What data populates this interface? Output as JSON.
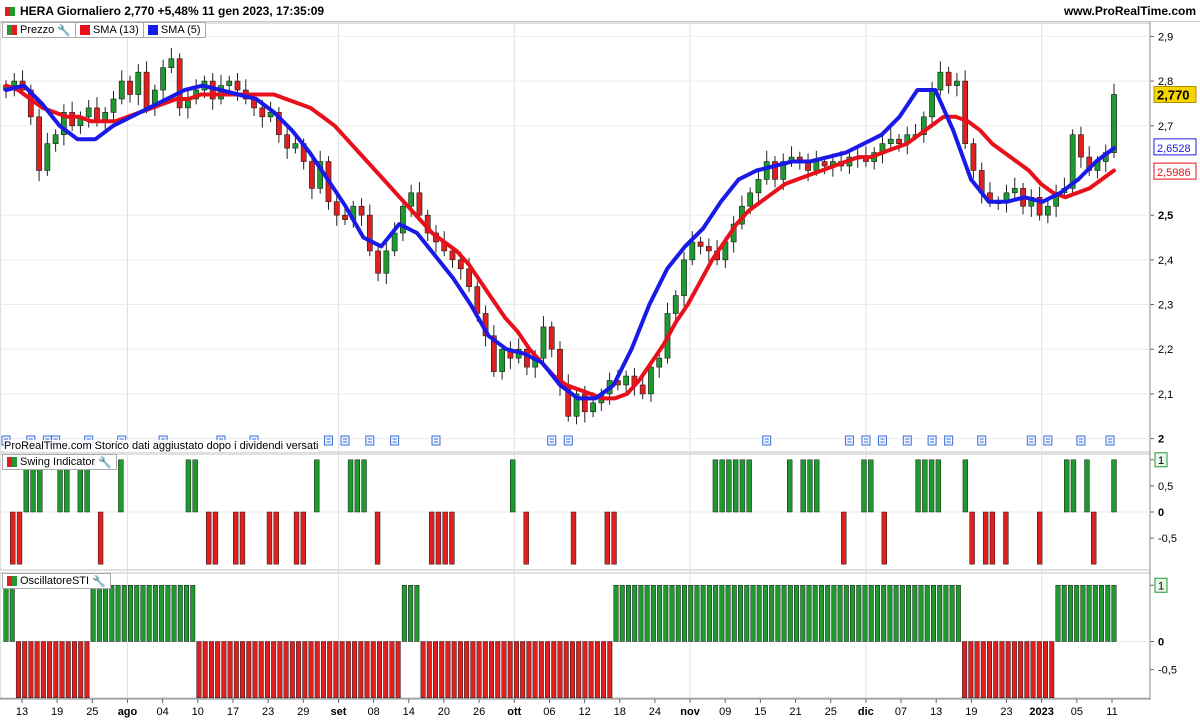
{
  "header": {
    "title": "HERA Giornaliero 2,770 +5,48% 11 gen 2023, 17:35:09",
    "site": "www.ProRealTime.com"
  },
  "legend_main": [
    {
      "label": "Prezzo",
      "color_a": "#d62728",
      "color_b": "#1a8f2e",
      "icon": "wrench-icon"
    },
    {
      "label": "SMA (13)",
      "color": "#e8101a"
    },
    {
      "label": "SMA (5)",
      "color": "#1a1ae8"
    }
  ],
  "legend_swing": {
    "label": "Swing Indicator",
    "icon": "wrench-icon"
  },
  "legend_osc": {
    "label": "OscillatoreSTI",
    "icon": "wrench-icon"
  },
  "note": "ProRealTime.com Storico dati aggiustato dopo i dividendi versati",
  "colors": {
    "up": "#1f9a30",
    "down": "#e02020",
    "sma13": "#e8101a",
    "sma5": "#1a1ae8",
    "price_bg": "#f5d400"
  },
  "price_labels": {
    "last": "2,770",
    "sma5": "2,6528",
    "sma13": "2,5986"
  },
  "chart_data": [
    {
      "type": "candlestick",
      "title": "HERA Giornaliero",
      "ylim": [
        1.97,
        2.93
      ],
      "y_ticks": [
        "2,9",
        "2,8",
        "2,7",
        "2,5",
        "2,4",
        "2,3",
        "2,2",
        "2,1",
        "2"
      ],
      "y_tick_values": [
        2.9,
        2.8,
        2.7,
        2.5,
        2.4,
        2.3,
        2.2,
        2.1,
        2.0
      ],
      "x_labels": [
        "13",
        "19",
        "25",
        "ago",
        "04",
        "10",
        "17",
        "23",
        "29",
        "set",
        "08",
        "14",
        "20",
        "26",
        "ott",
        "06",
        "12",
        "18",
        "24",
        "nov",
        "09",
        "15",
        "21",
        "25",
        "dic",
        "07",
        "13",
        "19",
        "23",
        "2023",
        "05",
        "11"
      ],
      "x_label_bold": [
        "ago",
        "set",
        "ott",
        "nov",
        "dic",
        "2023"
      ],
      "close": [
        2.79,
        2.8,
        2.78,
        2.72,
        2.6,
        2.66,
        2.68,
        2.73,
        2.7,
        2.72,
        2.74,
        2.71,
        2.73,
        2.76,
        2.8,
        2.77,
        2.82,
        2.74,
        2.78,
        2.83,
        2.85,
        2.74,
        2.76,
        2.78,
        2.8,
        2.76,
        2.79,
        2.8,
        2.78,
        2.76,
        2.74,
        2.72,
        2.73,
        2.68,
        2.65,
        2.66,
        2.62,
        2.56,
        2.62,
        2.53,
        2.5,
        2.49,
        2.52,
        2.5,
        2.42,
        2.37,
        2.42,
        2.46,
        2.52,
        2.55,
        2.5,
        2.46,
        2.44,
        2.42,
        2.4,
        2.38,
        2.34,
        2.28,
        2.23,
        2.15,
        2.2,
        2.18,
        2.2,
        2.16,
        2.18,
        2.25,
        2.2,
        2.12,
        2.05,
        2.1,
        2.06,
        2.08,
        2.1,
        2.13,
        2.12,
        2.14,
        2.12,
        2.1,
        2.16,
        2.18,
        2.28,
        2.32,
        2.4,
        2.44,
        2.43,
        2.42,
        2.4,
        2.44,
        2.48,
        2.52,
        2.55,
        2.58,
        2.62,
        2.58,
        2.62,
        2.63,
        2.62,
        2.6,
        2.62,
        2.61,
        2.62,
        2.61,
        2.63,
        2.63,
        2.62,
        2.64,
        2.66,
        2.67,
        2.66,
        2.68,
        2.68,
        2.72,
        2.78,
        2.82,
        2.79,
        2.8,
        2.66,
        2.6,
        2.55,
        2.53,
        2.53,
        2.55,
        2.56,
        2.52,
        2.54,
        2.5,
        2.52,
        2.55,
        2.56,
        2.68,
        2.63,
        2.6,
        2.62,
        2.64,
        2.77
      ],
      "series": [
        {
          "name": "SMA (13)",
          "values": [
            2.79,
            2.78,
            2.76,
            2.74,
            2.73,
            2.72,
            2.72,
            2.71,
            2.71,
            2.71,
            2.72,
            2.73,
            2.74,
            2.75,
            2.76,
            2.76,
            2.77,
            2.77,
            2.77,
            2.77,
            2.77,
            2.77,
            2.77,
            2.76,
            2.75,
            2.74,
            2.72,
            2.7,
            2.67,
            2.64,
            2.61,
            2.58,
            2.55,
            2.52,
            2.49,
            2.46,
            2.44,
            2.42,
            2.39,
            2.35,
            2.31,
            2.27,
            2.24,
            2.2,
            2.17,
            2.14,
            2.12,
            2.11,
            2.1,
            2.09,
            2.09,
            2.1,
            2.13,
            2.17,
            2.21,
            2.26,
            2.3,
            2.35,
            2.4,
            2.44,
            2.48,
            2.51,
            2.53,
            2.55,
            2.57,
            2.58,
            2.59,
            2.6,
            2.61,
            2.62,
            2.63,
            2.63,
            2.64,
            2.65,
            2.66,
            2.68,
            2.7,
            2.72,
            2.72,
            2.71,
            2.69,
            2.66,
            2.64,
            2.62,
            2.6,
            2.57,
            2.55,
            2.54,
            2.55,
            2.56,
            2.58,
            2.6
          ]
        },
        {
          "name": "SMA (5)",
          "values": [
            2.78,
            2.79,
            2.75,
            2.7,
            2.67,
            2.67,
            2.7,
            2.72,
            2.74,
            2.76,
            2.78,
            2.79,
            2.78,
            2.77,
            2.76,
            2.73,
            2.69,
            2.64,
            2.58,
            2.52,
            2.45,
            2.43,
            2.48,
            2.46,
            2.41,
            2.36,
            2.3,
            2.23,
            2.2,
            2.19,
            2.17,
            2.12,
            2.09,
            2.09,
            2.12,
            2.2,
            2.3,
            2.38,
            2.43,
            2.47,
            2.53,
            2.58,
            2.6,
            2.61,
            2.62,
            2.62,
            2.63,
            2.64,
            2.66,
            2.68,
            2.72,
            2.78,
            2.78,
            2.69,
            2.58,
            2.53,
            2.53,
            2.54,
            2.53,
            2.55,
            2.58,
            2.62,
            2.65
          ]
        }
      ]
    },
    {
      "type": "bar",
      "title": "Swing Indicator",
      "ylim": [
        -1,
        1
      ],
      "y_ticks": [
        "1",
        "0,5",
        "0",
        "-0,5"
      ],
      "values": [
        0,
        -1,
        -1,
        1,
        1,
        1,
        0,
        0,
        1,
        1,
        0,
        1,
        1,
        0,
        -1,
        0,
        0,
        1,
        0,
        0,
        0,
        0,
        0,
        0,
        0,
        0,
        0,
        1,
        1,
        0,
        -1,
        -1,
        0,
        0,
        -1,
        -1,
        0,
        0,
        0,
        -1,
        -1,
        0,
        0,
        -1,
        -1,
        0,
        1,
        0,
        0,
        0,
        0,
        1,
        1,
        1,
        0,
        -1,
        0,
        0,
        0,
        0,
        0,
        0,
        0,
        -1,
        -1,
        -1,
        -1,
        0,
        0,
        0,
        0,
        0,
        0,
        0,
        0,
        1,
        0,
        -1,
        0,
        0,
        0,
        0,
        0,
        0,
        -1,
        0,
        0,
        0,
        0,
        -1,
        -1,
        0,
        0,
        0,
        0,
        0,
        0,
        0,
        0,
        0,
        0,
        0,
        0,
        0,
        0,
        1,
        1,
        1,
        1,
        1,
        1,
        0,
        0,
        0,
        0,
        0,
        1,
        0,
        1,
        1,
        1,
        0,
        0,
        0,
        -1,
        0,
        0,
        1,
        1,
        0,
        -1,
        0,
        0,
        0,
        0,
        1,
        1,
        1,
        1,
        0,
        0,
        0,
        1,
        -1,
        0,
        -1,
        -1,
        0,
        -1,
        0,
        0,
        0,
        0,
        -1,
        0,
        0,
        0,
        1,
        1,
        0,
        1,
        -1,
        0,
        0,
        1
      ]
    },
    {
      "type": "bar",
      "title": "OscillatoreSTI",
      "ylim": [
        -1,
        1
      ],
      "y_ticks": [
        "1",
        "0",
        "-0,5"
      ],
      "values": [
        1,
        1,
        -1,
        -1,
        -1,
        -1,
        -1,
        -1,
        -1,
        -1,
        -1,
        -1,
        -1,
        -1,
        1,
        1,
        1,
        1,
        1,
        1,
        1,
        1,
        1,
        1,
        1,
        1,
        1,
        1,
        1,
        1,
        1,
        -1,
        -1,
        -1,
        -1,
        -1,
        -1,
        -1,
        -1,
        -1,
        -1,
        -1,
        -1,
        -1,
        -1,
        -1,
        -1,
        -1,
        -1,
        -1,
        -1,
        -1,
        -1,
        -1,
        -1,
        -1,
        -1,
        -1,
        -1,
        -1,
        -1,
        -1,
        -1,
        -1,
        1,
        1,
        1,
        -1,
        -1,
        -1,
        -1,
        -1,
        -1,
        -1,
        -1,
        -1,
        -1,
        -1,
        -1,
        -1,
        -1,
        -1,
        -1,
        -1,
        -1,
        -1,
        -1,
        -1,
        -1,
        -1,
        -1,
        -1,
        -1,
        -1,
        -1,
        -1,
        -1,
        -1,
        1,
        1,
        1,
        1,
        1,
        1,
        1,
        1,
        1,
        1,
        1,
        1,
        1,
        1,
        1,
        1,
        1,
        1,
        1,
        1,
        1,
        1,
        1,
        1,
        1,
        1,
        1,
        1,
        1,
        1,
        1,
        1,
        1,
        1,
        1,
        1,
        1,
        1,
        1,
        1,
        1,
        1,
        1,
        1,
        1,
        1,
        1,
        1,
        1,
        1,
        1,
        1,
        1,
        1,
        1,
        1,
        -1,
        -1,
        -1,
        -1,
        -1,
        -1,
        -1,
        -1,
        -1,
        -1,
        -1,
        -1,
        -1,
        -1,
        -1,
        1,
        1,
        1,
        1,
        1,
        1,
        1,
        1,
        1,
        1
      ]
    }
  ]
}
